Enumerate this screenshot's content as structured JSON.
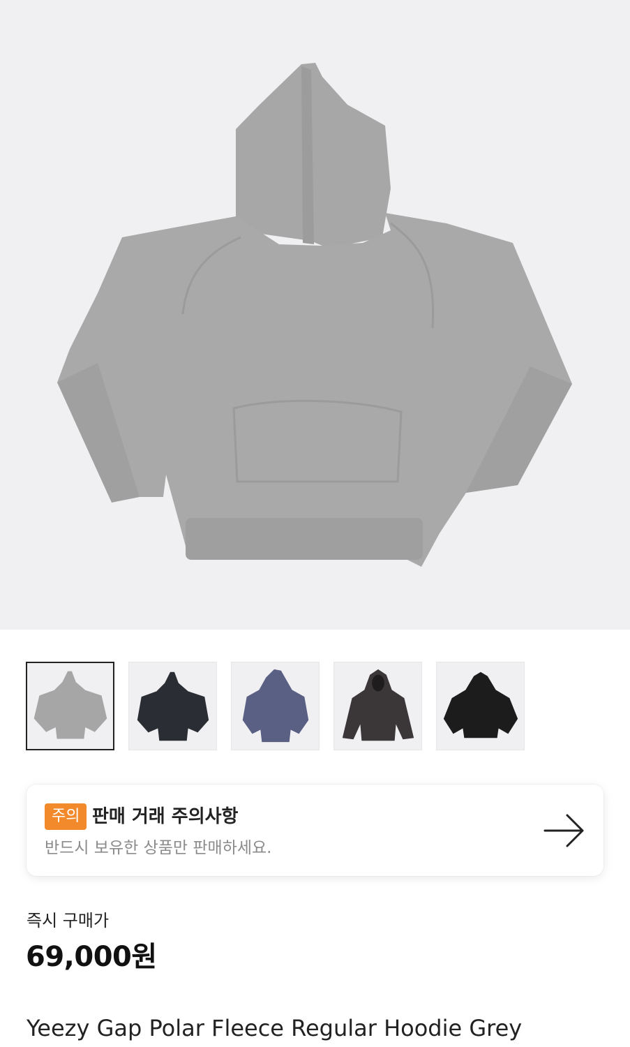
{
  "hero": {
    "image": "grey-hoodie-photo",
    "background": "#f0f0f2"
  },
  "thumbnails": [
    {
      "name": "grey-hoodie-thumb",
      "color": "#a6a6a6",
      "selected": true
    },
    {
      "name": "black-hoodie-thumb",
      "color": "#2a2d33",
      "selected": false
    },
    {
      "name": "navy-hoodie-thumb",
      "color": "#5a5f84",
      "selected": false
    },
    {
      "name": "washed-black-hoodie-thumb",
      "color": "#3b3638",
      "selected": false
    },
    {
      "name": "black-hoodie-thumb-2",
      "color": "#1c1c1c",
      "selected": false
    }
  ],
  "notice": {
    "badge": "주의",
    "title": "판매 거래 주의사항",
    "subtitle": "반드시 보유한 상품만 판매하세요.",
    "badge_color": "#f2892a",
    "icon": "arrow-right-icon"
  },
  "price": {
    "label": "즉시 구매가",
    "value": "69,000원"
  },
  "product": {
    "name": "Yeezy Gap Polar Fleece Regular Hoodie Grey"
  }
}
